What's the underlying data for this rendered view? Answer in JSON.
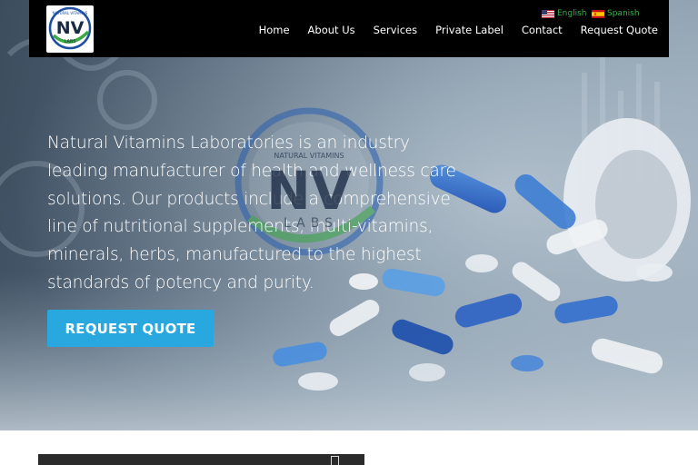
{
  "header": {
    "logo": {
      "text": "NV",
      "subtext": "LABS",
      "ring_text": "NATURAL VITAMINS"
    },
    "languages": [
      {
        "label": "English",
        "flag": "us-flag-icon"
      },
      {
        "label": "Spanish",
        "flag": "es-flag-icon"
      }
    ],
    "nav": [
      {
        "label": "Home"
      },
      {
        "label": "About Us"
      },
      {
        "label": "Services"
      },
      {
        "label": "Private Label"
      },
      {
        "label": "Contact"
      },
      {
        "label": "Request Quote"
      }
    ]
  },
  "hero": {
    "watermark": {
      "ring_text": "NATURAL VITAMINS",
      "text": "NV",
      "subtext": "LABS"
    },
    "description": "Natural Vitamins Laboratories is an industry leading manufacturer of health and wellness care solutions. Our products include a comprehensive line of nutritional supplements, multi-vitamins, minerals, herbs, manufactured to the highest standards of potency and purity.",
    "cta_label": "REQUEST QUOTE"
  },
  "colors": {
    "accent": "#29a8e0",
    "nav_bg": "#000000",
    "language_link": "#36b24a",
    "logo_blue": "#1f4fa0",
    "logo_green": "#3aa845"
  }
}
